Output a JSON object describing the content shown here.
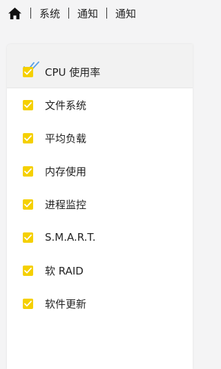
{
  "breadcrumb": {
    "home_icon": "home-icon",
    "items": [
      "系统",
      "通知",
      "通知"
    ]
  },
  "panel": {
    "header_icon": "double-check-icon",
    "accent_color": "#5aa0e6",
    "checkbox_color": "#f5d000",
    "items": [
      {
        "label": "CPU 使用率",
        "checked": true
      },
      {
        "label": "文件系统",
        "checked": true
      },
      {
        "label": "平均负载",
        "checked": true
      },
      {
        "label": "内存使用",
        "checked": true
      },
      {
        "label": "进程监控",
        "checked": true
      },
      {
        "label": "S.M.A.R.T.",
        "checked": true
      },
      {
        "label": "软 RAID",
        "checked": true
      },
      {
        "label": "软件更新",
        "checked": true
      }
    ]
  }
}
